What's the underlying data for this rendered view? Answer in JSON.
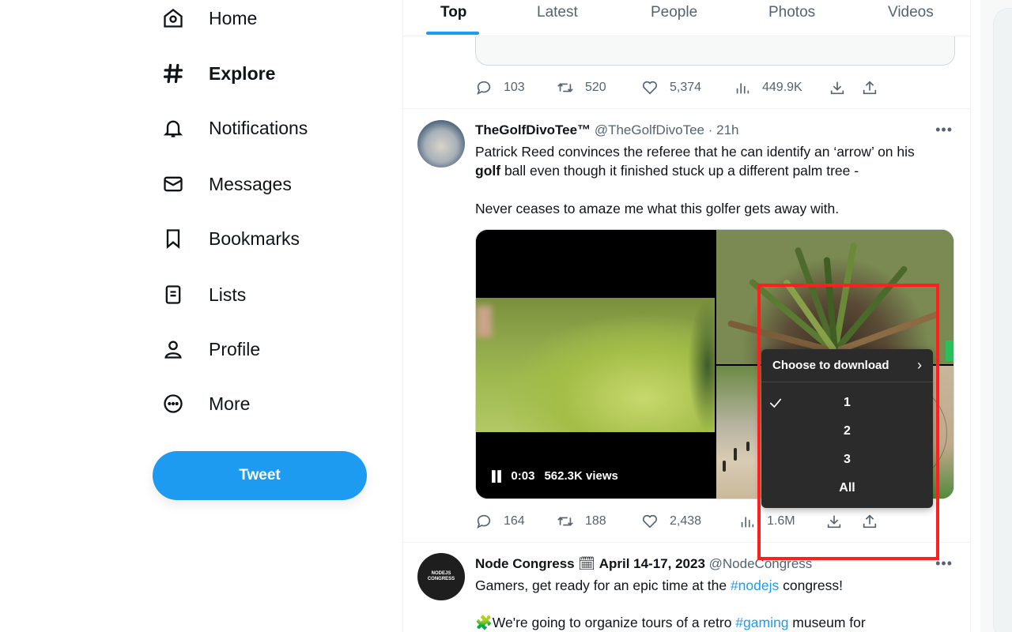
{
  "sidebar": {
    "items": [
      {
        "label": "Home",
        "icon": "home-icon"
      },
      {
        "label": "Explore",
        "icon": "hashtag-icon",
        "active": true
      },
      {
        "label": "Notifications",
        "icon": "bell-icon"
      },
      {
        "label": "Messages",
        "icon": "envelope-icon"
      },
      {
        "label": "Bookmarks",
        "icon": "bookmark-icon"
      },
      {
        "label": "Lists",
        "icon": "list-icon"
      },
      {
        "label": "Profile",
        "icon": "person-icon"
      },
      {
        "label": "More",
        "icon": "more-circle-icon"
      }
    ],
    "tweet_button": "Tweet"
  },
  "tabs": [
    "Top",
    "Latest",
    "People",
    "Photos",
    "Videos"
  ],
  "active_tab": "Top",
  "prev_tweet": {
    "stats": {
      "replies": "103",
      "retweets": "520",
      "likes": "5,374",
      "views": "449.9K"
    }
  },
  "tweet1": {
    "name": "TheGolfDivoTee™",
    "handle": "@TheGolfDivoTee",
    "time": "21h",
    "text_part1": "Patrick Reed convinces the referee that he can identify an ‘arrow’ on his",
    "text_bold": "golf",
    "text_part2": " ball even though it finished stuck up a different palm tree -",
    "text_line3": "Never ceases to amaze me what this golfer gets away with.",
    "video": {
      "time": "0:03",
      "views": "562.3K views"
    },
    "stats": {
      "replies": "164",
      "retweets": "188",
      "likes": "2,438",
      "views": "1.6M"
    }
  },
  "download_menu": {
    "title": "Choose to download",
    "options": [
      "1",
      "2",
      "3",
      "All"
    ],
    "selected": "1"
  },
  "tweet2": {
    "avatar_text": "NODEJS CONGRESS",
    "name_part1": "Node Congress",
    "name_emoji": "🗓",
    "name_part2": "April 14-17, 2023",
    "handle": "@NodeCongress",
    "text_part1": "Gamers, get ready for an epic time at the ",
    "hashtag1": "#nodejs",
    "text_part2": " congress!",
    "line2_emoji": "🧩",
    "line2_text": "We're going to organize tours of a retro ",
    "hashtag2": "#gaming",
    "line2_tail": " museum for"
  },
  "colors": {
    "accent": "#1d9bf0",
    "highlight": "#ff1f1f",
    "menu_bg": "#2b2b2b"
  }
}
